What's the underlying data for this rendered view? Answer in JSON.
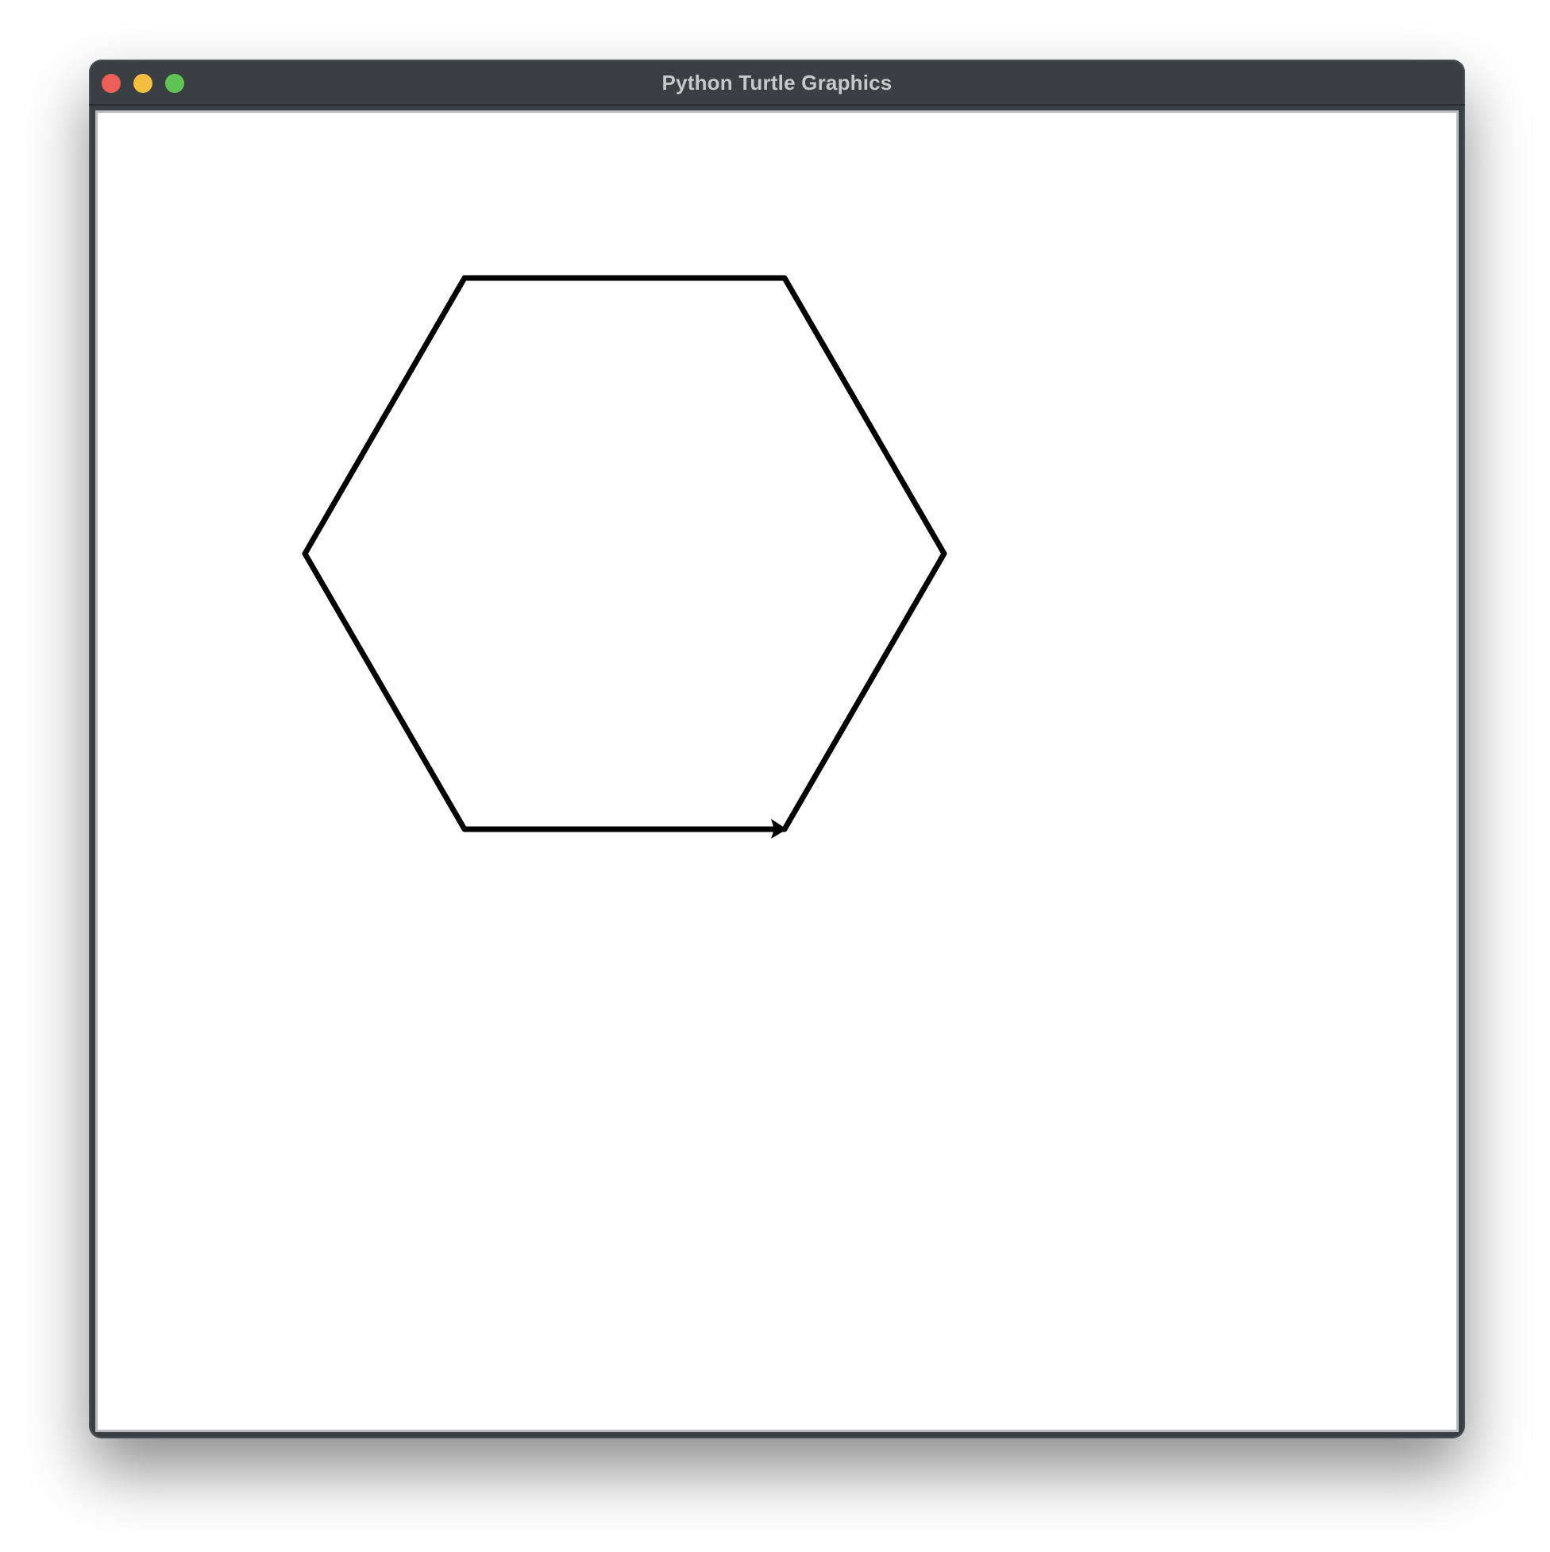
{
  "window": {
    "title": "Python Turtle Graphics"
  },
  "traffic_lights": {
    "close_color": "#ee5f57",
    "minimize_color": "#f5be3f",
    "zoom_color": "#5fc453"
  },
  "canvas": {
    "background": "#ffffff",
    "shape": {
      "type": "regular-hexagon",
      "stroke_color": "#000000"
    },
    "turtle_icon": "arrow-cursor-icon",
    "turtle_color": "#000000"
  }
}
